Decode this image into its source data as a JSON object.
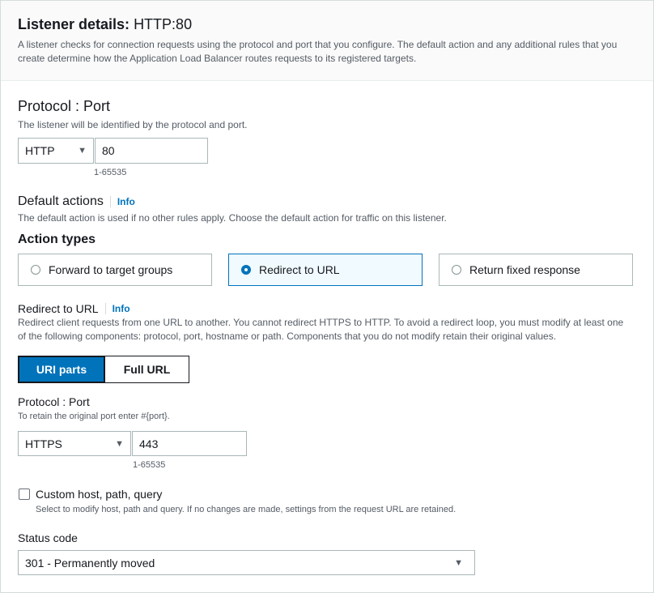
{
  "header": {
    "title_label": "Listener details:",
    "title_value": "HTTP:80",
    "description": "A listener checks for connection requests using the protocol and port that you configure. The default action and any additional rules that you create determine how the Application Load Balancer routes requests to its registered targets."
  },
  "protocol_port": {
    "heading": "Protocol : Port",
    "description": "The listener will be identified by the protocol and port.",
    "protocol_value": "HTTP",
    "port_value": "80",
    "port_hint": "1-65535"
  },
  "default_actions": {
    "heading": "Default actions",
    "info_label": "Info",
    "description": "The default action is used if no other rules apply. Choose the default action for traffic on this listener.",
    "action_types_label": "Action types",
    "options": [
      {
        "label": "Forward to target groups",
        "selected": false
      },
      {
        "label": "Redirect to URL",
        "selected": true
      },
      {
        "label": "Return fixed response",
        "selected": false
      }
    ]
  },
  "redirect": {
    "heading": "Redirect to URL",
    "info_label": "Info",
    "description": "Redirect client requests from one URL to another. You cannot redirect HTTPS to HTTP. To avoid a redirect loop, you must modify at least one of the following components: protocol, port, hostname or path. Components that you do not modify retain their original values.",
    "segments": [
      {
        "label": "URI parts",
        "selected": true
      },
      {
        "label": "Full URL",
        "selected": false
      }
    ],
    "protocol_port_label": "Protocol : Port",
    "protocol_port_hint": "To retain the original port enter #{port}.",
    "protocol_value": "HTTPS",
    "port_value": "443",
    "port_hint": "1-65535",
    "custom_label": "Custom host, path, query",
    "custom_checked": false,
    "custom_description": "Select to modify host, path and query. If no changes are made, settings from the request URL are retained.",
    "status_code_label": "Status code",
    "status_code_value": "301 - Permanently moved"
  },
  "icons": {
    "dropdown": "caret-down-icon"
  },
  "colors": {
    "accent": "#0073bb",
    "selected_tile_bg": "#f1faff",
    "text": "#16191f",
    "secondary_text": "#545b64"
  }
}
